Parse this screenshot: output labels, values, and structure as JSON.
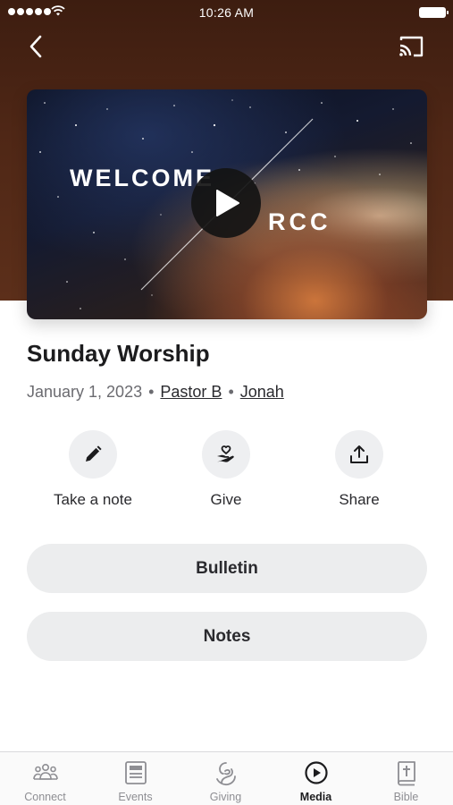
{
  "status_bar": {
    "time": "10:26 AM"
  },
  "nav": {
    "back_icon": "chevron-left-icon",
    "cast_icon": "cast-icon"
  },
  "video": {
    "title_left": "WELCOME",
    "title_right": "RCC",
    "play_icon": "play-icon"
  },
  "sermon": {
    "title": "Sunday Worship",
    "date": "January 1, 2023",
    "separator": "•",
    "speaker": "Pastor B",
    "series": "Jonah"
  },
  "actions": [
    {
      "label": "Take a note",
      "icon": "pencil-icon"
    },
    {
      "label": "Give",
      "icon": "hand-heart-icon"
    },
    {
      "label": "Share",
      "icon": "share-icon"
    }
  ],
  "buttons": {
    "bulletin": "Bulletin",
    "notes": "Notes"
  },
  "tabs": [
    {
      "label": "Connect",
      "icon": "people-icon"
    },
    {
      "label": "Events",
      "icon": "newspaper-icon"
    },
    {
      "label": "Giving",
      "icon": "giving-icon"
    },
    {
      "label": "Media",
      "icon": "play-circle-icon",
      "active": true
    },
    {
      "label": "Bible",
      "icon": "bible-icon"
    }
  ],
  "colors": {
    "hero_background": "#4f2716",
    "pill_background": "#ecedee",
    "active_tab": "#1c1c1e",
    "inactive_tab": "#8e8e93"
  }
}
